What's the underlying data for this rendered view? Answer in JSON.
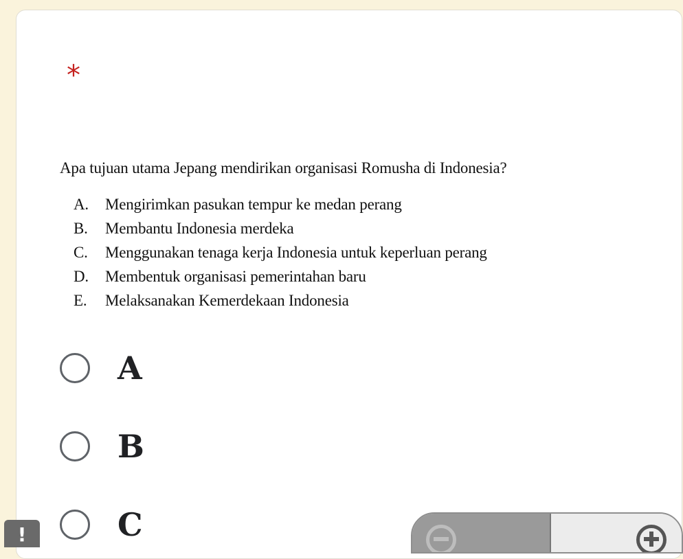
{
  "question": {
    "required_marker": "*",
    "text": "Apa tujuan utama Jepang mendirikan organisasi Romusha di Indonesia?",
    "printed_choices": [
      {
        "letter": "A.",
        "text": "Mengirimkan pasukan tempur ke medan perang"
      },
      {
        "letter": "B.",
        "text": "Membantu Indonesia merdeka"
      },
      {
        "letter": "C.",
        "text": "Menggunakan tenaga kerja Indonesia untuk keperluan perang"
      },
      {
        "letter": "D.",
        "text": "Membentuk organisasi pemerintahan baru"
      },
      {
        "letter": "E.",
        "text": "Melaksanakan Kemerdekaan Indonesia"
      }
    ]
  },
  "options": [
    {
      "label": "A",
      "selected": false
    },
    {
      "label": "B",
      "selected": false
    },
    {
      "label": "C",
      "selected": false
    }
  ],
  "feedback_button": {
    "label": "!"
  },
  "zoom": {
    "zoom_out_icon": "zoom-out-icon",
    "zoom_in_icon": "zoom-in-icon"
  },
  "colors": {
    "page_background": "#faf3dc",
    "card_background": "#ffffff",
    "required": "#c5221f",
    "radio_border": "#5f6368"
  }
}
